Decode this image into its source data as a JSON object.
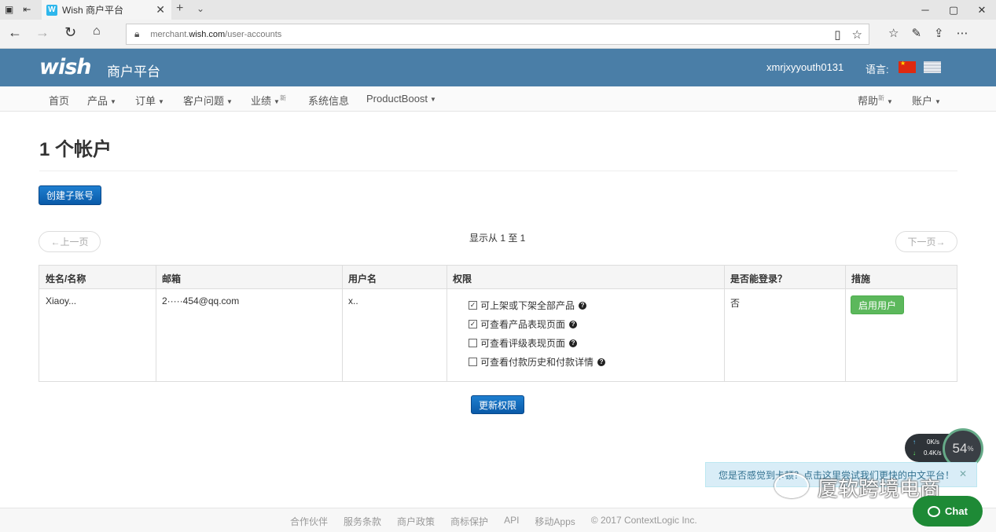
{
  "browser": {
    "tab_title": "Wish 商户平台",
    "tab_favicon": "W",
    "url_prefix": "merchant.",
    "url_domain": "wish.com",
    "url_path": "/user-accounts"
  },
  "header": {
    "logo": "wish",
    "logo_sub": "商户平台",
    "username": "xmrjxyyouth0131",
    "language_label": "语言:"
  },
  "nav": {
    "home": "首页",
    "products": "产品",
    "orders": "订单",
    "customer_issues": "客户问题",
    "performance": "业绩",
    "performance_badge": "新",
    "system_info": "系统信息",
    "productboost": "ProductBoost",
    "help": "帮助",
    "help_badge": "新",
    "account": "账户"
  },
  "page": {
    "title": "1 个帐户",
    "create_button": "创建子账号",
    "prev_button": "←上一页",
    "next_button": "下一页→",
    "showing": "显示从 1 至 1",
    "update_button": "更新权限"
  },
  "table": {
    "headers": [
      "姓名/名称",
      "邮箱",
      "用户名",
      "权限",
      "是否能登录？",
      "措施"
    ],
    "rows": [
      {
        "name": "Xiaoy...",
        "email": "2·····454@qq.com",
        "username": "x..",
        "permissions": [
          {
            "label": "可上架或下架全部产品",
            "checked": true
          },
          {
            "label": "可查看产品表现页面",
            "checked": true
          },
          {
            "label": "可查看评级表现页面",
            "checked": false
          },
          {
            "label": "可查看付款历史和付款详情",
            "checked": false
          }
        ],
        "can_login": "否",
        "action": "启用用户"
      }
    ]
  },
  "widgets": {
    "speed_up": "0K/s",
    "speed_down": "0.4K/s",
    "percent": "54",
    "notice": "您是否感觉到卡顿？点击这里尝试我们更快的中文平台！",
    "watermark": "厦软跨境电商",
    "chat": "Chat"
  },
  "footer": {
    "links": [
      "合作伙伴",
      "服务条款",
      "商户政策",
      "商标保护",
      "API",
      "移动Apps",
      "© 2017 ContextLogic Inc."
    ]
  },
  "colors": {
    "header_bg": "#4a7ea7",
    "primary_button": "#0a5aa8",
    "success_button": "#5cb85c",
    "chat_button": "#1e8a36"
  }
}
